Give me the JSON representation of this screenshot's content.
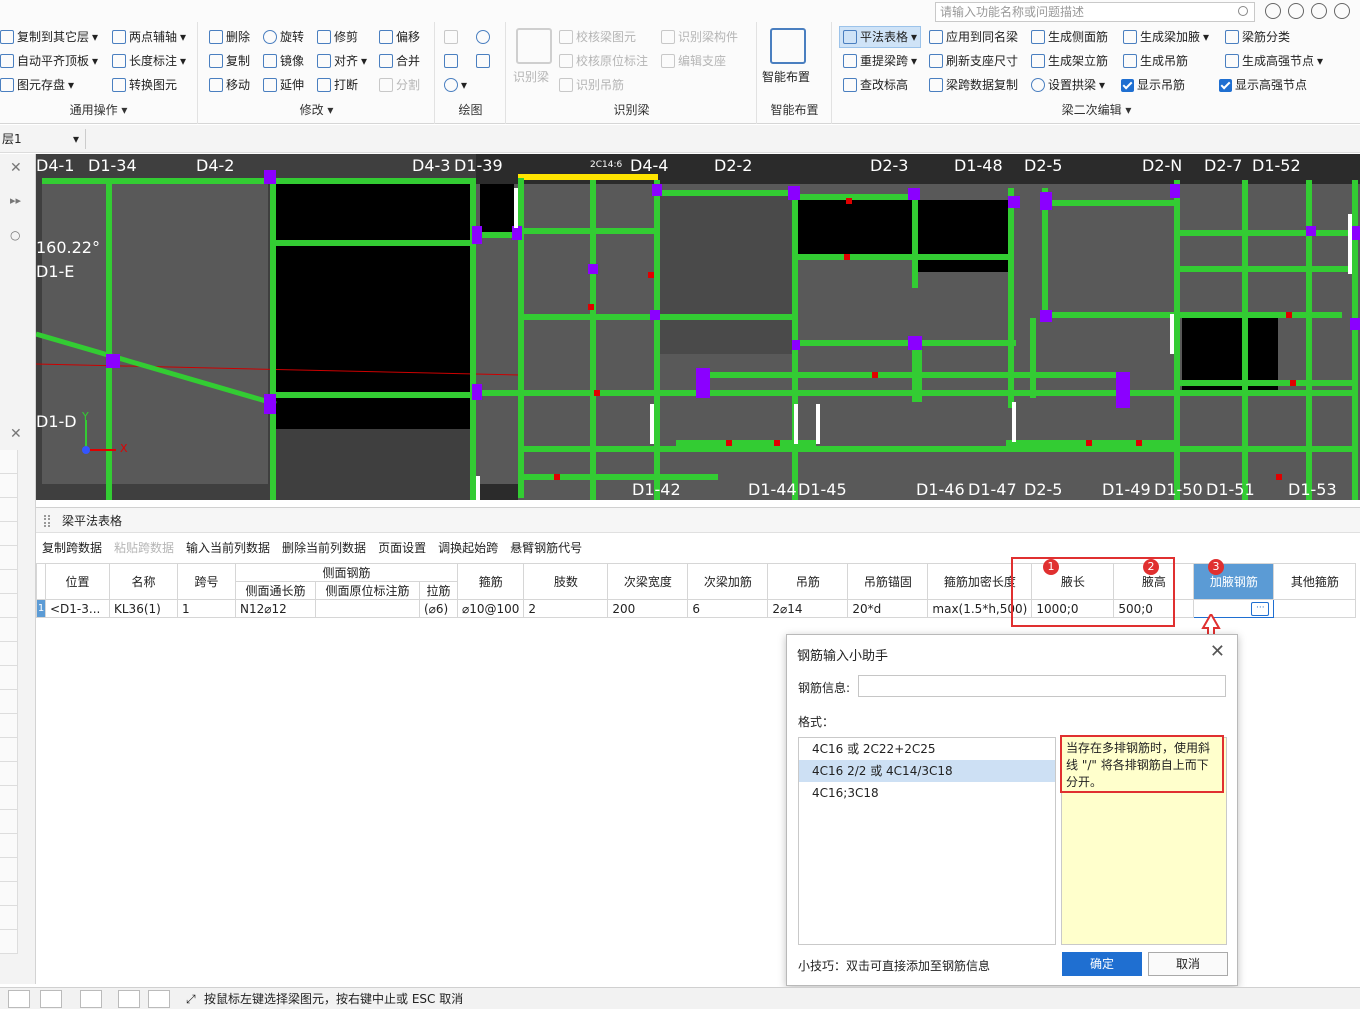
{
  "ribbon": {
    "search_placeholder": "请输入功能名称或问题描述",
    "groups": {
      "common": {
        "title": "通用操作",
        "items": [
          "复制到其它层",
          "两点辅轴",
          "自动平齐顶板",
          "长度标注",
          "图元存盘",
          "转换图元"
        ]
      },
      "modify": {
        "title": "修改",
        "items": [
          "删除",
          "旋转",
          "修剪",
          "偏移",
          "复制",
          "镜像",
          "对齐",
          "合并",
          "移动",
          "延伸",
          "打断",
          "分割"
        ]
      },
      "draw": {
        "title": "绘图"
      },
      "recognize": {
        "title": "识别梁",
        "big": "识别梁",
        "items": [
          "校核梁图元",
          "识别梁构件",
          "校核原位标注",
          "编辑支座",
          "识别吊筋"
        ]
      },
      "smart": {
        "title": "智能布置",
        "big": "智能布置"
      },
      "secondary": {
        "title": "梁二次编辑",
        "items": [
          "平法表格",
          "应用到同名梁",
          "生成侧面筋",
          "生成梁加腋",
          "梁筋分类",
          "重提梁跨",
          "刷新支座尺寸",
          "生成架立筋",
          "生成吊筋",
          "生成高强节点",
          "查改标高",
          "梁跨数据复制",
          "设置拱梁",
          "显示吊筋",
          "显示高强节点"
        ]
      }
    }
  },
  "floor": {
    "selected": "层1"
  },
  "canvas": {
    "labels": [
      "D4-1",
      "D1-34",
      "D4-2",
      "D4-3",
      "D1-39",
      "D4-4",
      "D2-2",
      "D2-3",
      "D1-48",
      "D2-5",
      "D2-N",
      "D2-7",
      "D1-52",
      "D1-42",
      "D1-44",
      "D1-45",
      "D1-46",
      "D1-47",
      "D2-5",
      "D1-49",
      "D1-50",
      "D1-51",
      "D1-53"
    ],
    "angle": "160.22°",
    "axis_labels": [
      "D1-E",
      "D1-D"
    ],
    "beam_label": "2C14:6",
    "axis_x": "X",
    "axis_y": "Y"
  },
  "table": {
    "title": "梁平法表格",
    "toolbar": [
      {
        "label": "复制跨数据",
        "enabled": true
      },
      {
        "label": "粘贴跨数据",
        "enabled": false
      },
      {
        "label": "输入当前列数据",
        "enabled": true
      },
      {
        "label": "删除当前列数据",
        "enabled": true
      },
      {
        "label": "页面设置",
        "enabled": true
      },
      {
        "label": "调换起始跨",
        "enabled": true
      },
      {
        "label": "悬臂钢筋代号",
        "enabled": true
      }
    ],
    "group_header": "侧面钢筋",
    "headers": [
      "位置",
      "名称",
      "跨号",
      "侧面通长筋",
      "侧面原位标注筋",
      "拉筋",
      "箍筋",
      "肢数",
      "次梁宽度",
      "次梁加筋",
      "吊筋",
      "吊筋锚固",
      "箍筋加密长度",
      "腋长",
      "腋高",
      "加腋钢筋",
      "其他箍筋"
    ],
    "row": {
      "index": "1",
      "position": "<D1-3...",
      "name": "KL36(1)",
      "span": "1",
      "side_long": "N12⌀12",
      "side_mark": "",
      "tie": "(⌀6)",
      "stirrup": "⌀10@100",
      "legs": "2",
      "sub_width": "200",
      "sub_add": "6",
      "hanger": "2⌀14",
      "hanger_anchor": "20*d",
      "dense_len": "max(1.5*h,500)",
      "haunch_len": "1000;0",
      "haunch_h": "500;0",
      "haunch_bar": "",
      "other": ""
    },
    "badges": [
      "1",
      "2",
      "3"
    ]
  },
  "dialog": {
    "title": "钢筋输入小助手",
    "info_label": "钢筋信息:",
    "info_value": "",
    "format_label": "格式：",
    "formats": [
      "4C16 或 2C22+2C25",
      "4C16 2/2 或 4C14/3C18",
      "4C16;3C18"
    ],
    "selected_index": 1,
    "help": "当存在多排钢筋时，使用斜线 \"/\" 将各排钢筋自上而下分开。",
    "tip": "小技巧：双击可直接添加至钢筋信息",
    "ok": "确定",
    "cancel": "取消"
  },
  "status": {
    "text": "按鼠标左键选择梁图元，按右键中止或 ESC 取消"
  },
  "colors": {
    "accent": "#1f6fd1",
    "highlight": "#e03030",
    "beam_green": "#33cc33",
    "column_purple": "#8b00ff",
    "canvas_bg": "#2b2b2b"
  }
}
